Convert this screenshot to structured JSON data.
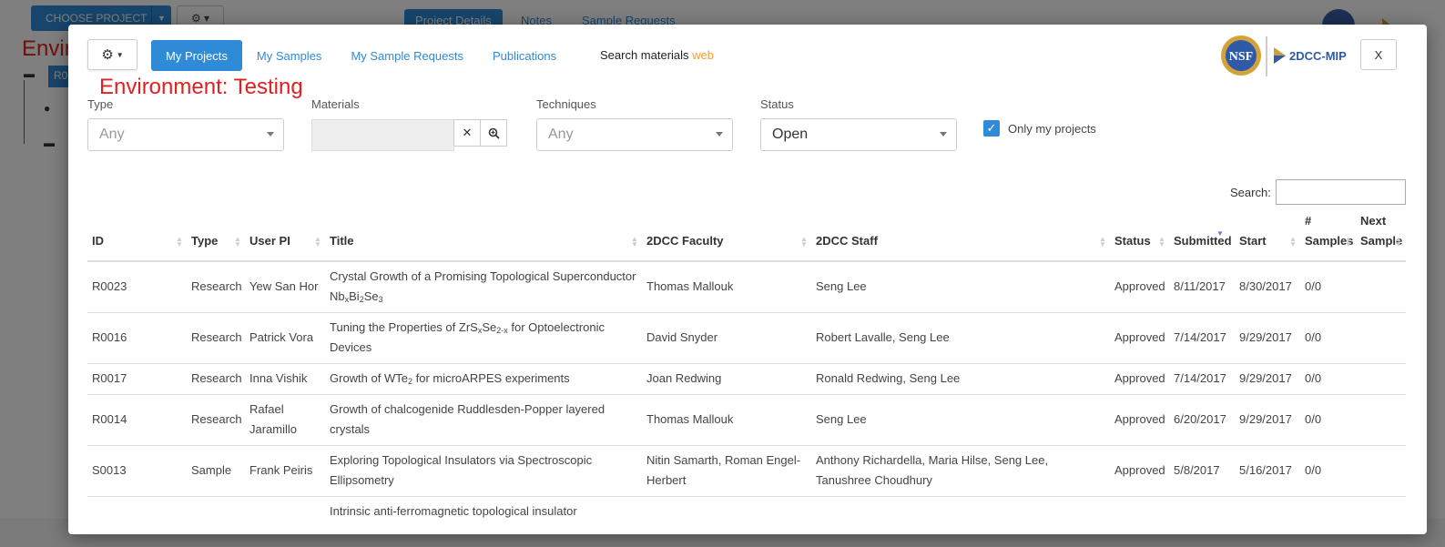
{
  "background": {
    "choose_label": "CHOOSE PROJECT",
    "env_text": "Envir",
    "chip_text": "R0",
    "tabs": [
      "Project Details",
      "Notes",
      "Sample Requests"
    ]
  },
  "header": {
    "nav": [
      "My Projects",
      "My Samples",
      "My Sample Requests",
      "Publications"
    ],
    "search_label": "Search materials",
    "search_web": "web",
    "logo_text": "2DCC-MIP",
    "nsf_text": "NSF",
    "close_label": "X"
  },
  "environment": "Environment: Testing",
  "filters": {
    "type_label": "Type",
    "type_value": "Any",
    "materials_label": "Materials",
    "techniques_label": "Techniques",
    "techniques_value": "Any",
    "status_label": "Status",
    "status_value": "Open",
    "only_mine_label": "Only my projects"
  },
  "table_search_label": "Search:",
  "columns": [
    "ID",
    "Type",
    "User PI",
    "Title",
    "2DCC Faculty",
    "2DCC Staff",
    "Status",
    "Submitted",
    "Start",
    "# Samples",
    "Next Sample"
  ],
  "rows": [
    {
      "id": "R0023",
      "type": "Research",
      "pi": "Yew San Hor",
      "title_a": "Crystal Growth of a Promising Topological Superconductor Nb",
      "sub1": "x",
      "title_b": "Bi",
      "sub2": "2",
      "title_c": "Se",
      "sub3": "3",
      "title_d": "",
      "faculty": "Thomas Mallouk",
      "staff": "Seng Lee",
      "status": "Approved",
      "submitted": "8/11/2017",
      "start": "8/30/2017",
      "samples": "0/0",
      "next": ""
    },
    {
      "id": "R0016",
      "type": "Research",
      "pi": "Patrick Vora",
      "title_a": "Tuning the Properties of ZrS",
      "sub1": "x",
      "title_b": "Se",
      "sub2": "2-x",
      "title_c": " for Optoelectronic Devices",
      "sub3": "",
      "title_d": "",
      "faculty": "David Snyder",
      "staff": "Robert Lavalle, Seng Lee",
      "status": "Approved",
      "submitted": "7/14/2017",
      "start": "9/29/2017",
      "samples": "0/0",
      "next": ""
    },
    {
      "id": "R0017",
      "type": "Research",
      "pi": "Inna Vishik",
      "title_a": "Growth of WTe",
      "sub1": "2",
      "title_b": " for microARPES experiments",
      "sub2": "",
      "title_c": "",
      "sub3": "",
      "title_d": "",
      "faculty": "Joan Redwing",
      "staff": "Ronald Redwing, Seng Lee",
      "status": "Approved",
      "submitted": "7/14/2017",
      "start": "9/29/2017",
      "samples": "0/0",
      "next": ""
    },
    {
      "id": "R0014",
      "type": "Research",
      "pi": "Rafael Jaramillo",
      "title_a": "Growth of chalcogenide Ruddlesden-Popper layered crystals",
      "sub1": "",
      "title_b": "",
      "sub2": "",
      "title_c": "",
      "sub3": "",
      "title_d": "",
      "faculty": "Thomas Mallouk",
      "staff": "Seng Lee",
      "status": "Approved",
      "submitted": "6/20/2017",
      "start": "9/29/2017",
      "samples": "0/0",
      "next": ""
    },
    {
      "id": "S0013",
      "type": "Sample",
      "pi": "Frank Peiris",
      "title_a": "Exploring Topological Insulators via Spectroscopic Ellipsometry",
      "sub1": "",
      "title_b": "",
      "sub2": "",
      "title_c": "",
      "sub3": "",
      "title_d": "",
      "faculty": "Nitin Samarth, Roman Engel-Herbert",
      "staff": "Anthony Richardella, Maria Hilse, Seng Lee, Tanushree Choudhury",
      "status": "Approved",
      "submitted": "5/8/2017",
      "start": "5/16/2017",
      "samples": "0/0",
      "next": ""
    },
    {
      "id": "",
      "type": "",
      "pi": "",
      "title_a": "Intrinsic anti-ferromagnetic topological insulator",
      "sub1": "",
      "title_b": "",
      "sub2": "",
      "title_c": "",
      "sub3": "",
      "title_d": "",
      "faculty": "",
      "staff": "",
      "status": "",
      "submitted": "",
      "start": "",
      "samples": "",
      "next": ""
    }
  ],
  "colors": {
    "accent": "#2f8ad8",
    "env": "#e02020",
    "web": "#f0a030"
  }
}
